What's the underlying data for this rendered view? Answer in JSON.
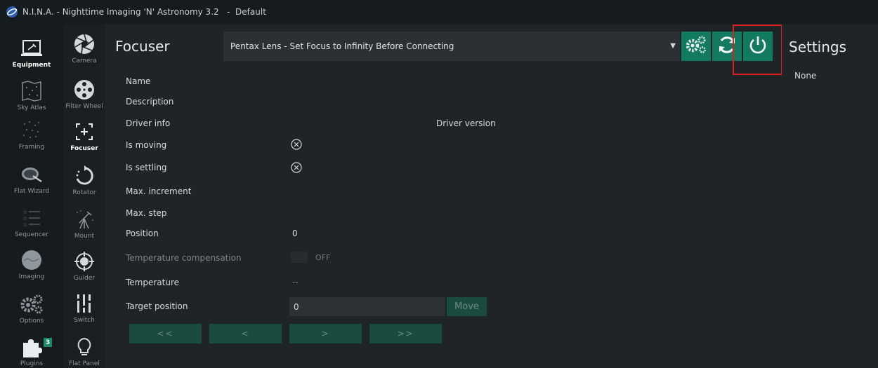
{
  "window": {
    "title": "N.I.N.A. - Nighttime Imaging 'N' Astronomy 3.2   -  Default"
  },
  "nav_primary": [
    {
      "label": "Equipment",
      "icon": "telescope-laptop-icon",
      "active": true
    },
    {
      "label": "Sky Atlas",
      "icon": "star-map-icon"
    },
    {
      "label": "Framing",
      "icon": "framing-icon"
    },
    {
      "label": "Flat Wizard",
      "icon": "flat-wizard-icon"
    },
    {
      "label": "Sequencer",
      "icon": "sequencer-icon"
    },
    {
      "label": "Imaging",
      "icon": "imaging-icon"
    },
    {
      "label": "Options",
      "icon": "gears-icon"
    },
    {
      "label": "Plugins",
      "icon": "puzzle-icon",
      "badge": "3"
    }
  ],
  "nav_equipment": [
    {
      "label": "Camera",
      "icon": "aperture-icon"
    },
    {
      "label": "Filter Wheel",
      "icon": "filter-wheel-icon"
    },
    {
      "label": "Focuser",
      "icon": "focuser-icon",
      "active": true
    },
    {
      "label": "Rotator",
      "icon": "rotator-icon"
    },
    {
      "label": "Mount",
      "icon": "mount-icon"
    },
    {
      "label": "Guider",
      "icon": "guider-icon"
    },
    {
      "label": "Switch",
      "icon": "switch-icon"
    },
    {
      "label": "Flat Panel",
      "icon": "flat-panel-icon"
    }
  ],
  "focuser": {
    "title": "Focuser",
    "device": "Pentax Lens - Set Focus to Infinity Before Connecting",
    "rows": {
      "name": "Name",
      "description": "Description",
      "driver_info": "Driver info",
      "driver_version": "Driver version",
      "is_moving": "Is moving",
      "is_settling": "Is settling",
      "max_increment": "Max. increment",
      "max_step": "Max. step",
      "position": "Position",
      "position_value": "0",
      "temp_comp": "Temperature compensation",
      "temp_comp_state": "OFF",
      "temperature": "Temperature",
      "temperature_value": "--",
      "target_position": "Target position",
      "target_position_value": "0"
    },
    "move_label": "Move",
    "step_buttons": [
      "<<",
      "<",
      ">",
      ">>"
    ]
  },
  "settings": {
    "title": "Settings",
    "value": "None"
  },
  "colors": {
    "accent": "#137a62",
    "highlight": "#e01e1e"
  }
}
